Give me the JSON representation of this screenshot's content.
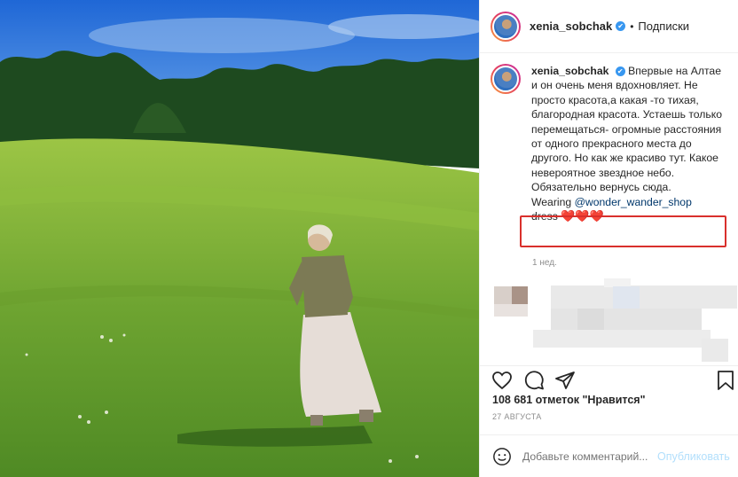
{
  "post": {
    "username": "xenia_sobchak",
    "verified_mark": "✔",
    "separator": "•",
    "follow_label": "Подписки"
  },
  "caption": {
    "username": "xenia_sobchak",
    "text": "Впервые на Алтае и он очень меня вдохновляет. Не просто красота,а какая -то тихая, благородная красота. Устаешь только перемещаться- огромные расстояния от одного прекрасного места до другого. Но как же красиво тут. Какое невероятное звездное небо. Обязательно вернусь сюда.",
    "wearing_prefix": "Wearing ",
    "mention": "@wonder_wander_shop",
    "dress_word": "dress ",
    "hearts": "❤️❤️❤️",
    "time_ago": "1 нед."
  },
  "actions": {
    "like_icon": "heart-outline-icon",
    "comment_icon": "comment-icon",
    "share_icon": "share-icon",
    "save_icon": "bookmark-icon"
  },
  "likes": {
    "count": "108 681",
    "label": "отметок \"Нравится\""
  },
  "date": "27 АВГУСТА",
  "comment_bar": {
    "emoji_icon": "smiley-icon",
    "placeholder": "Добавьте комментарий...",
    "publish_label": "Опубликовать"
  },
  "colors": {
    "highlight_box": "#d9302c",
    "verified": "#3897f0",
    "link": "#00376b",
    "publish_disabled": "#b2dffc"
  }
}
